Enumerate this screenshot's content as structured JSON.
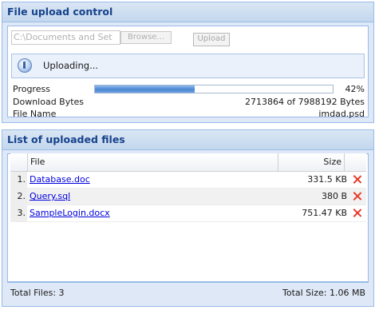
{
  "upload_panel": {
    "title": "File upload control",
    "file_input_value": "C:\\Documents and Set",
    "browse_label": "Browse...",
    "upload_label": "Upload",
    "status_text": "Uploading...",
    "progress_label": "Progress",
    "progress_percent": 42,
    "progress_text": "42%",
    "download_bytes_label": "Download Bytes",
    "download_bytes_value": "2713864 of 7988192 Bytes",
    "file_name_label": "File Name",
    "file_name_value": "imdad.psd"
  },
  "files_panel": {
    "title": "List of uploaded files",
    "columns": {
      "file": "File",
      "size": "Size"
    },
    "rows": [
      {
        "num": "1.",
        "name": "Database.doc",
        "size": "331.5 KB"
      },
      {
        "num": "2.",
        "name": "Query.sql",
        "size": "380 B"
      },
      {
        "num": "3.",
        "name": "SampleLogin.docx",
        "size": "751.47 KB"
      }
    ],
    "footer_left": "Total Files: 3",
    "footer_right": "Total Size: 1.06 MB"
  },
  "icons": {
    "status": "info-icon",
    "delete": "delete-x-icon"
  },
  "colors": {
    "header_text": "#15428b",
    "border": "#99bbe8",
    "link": "#0000dd",
    "delete": "#e8392b"
  }
}
